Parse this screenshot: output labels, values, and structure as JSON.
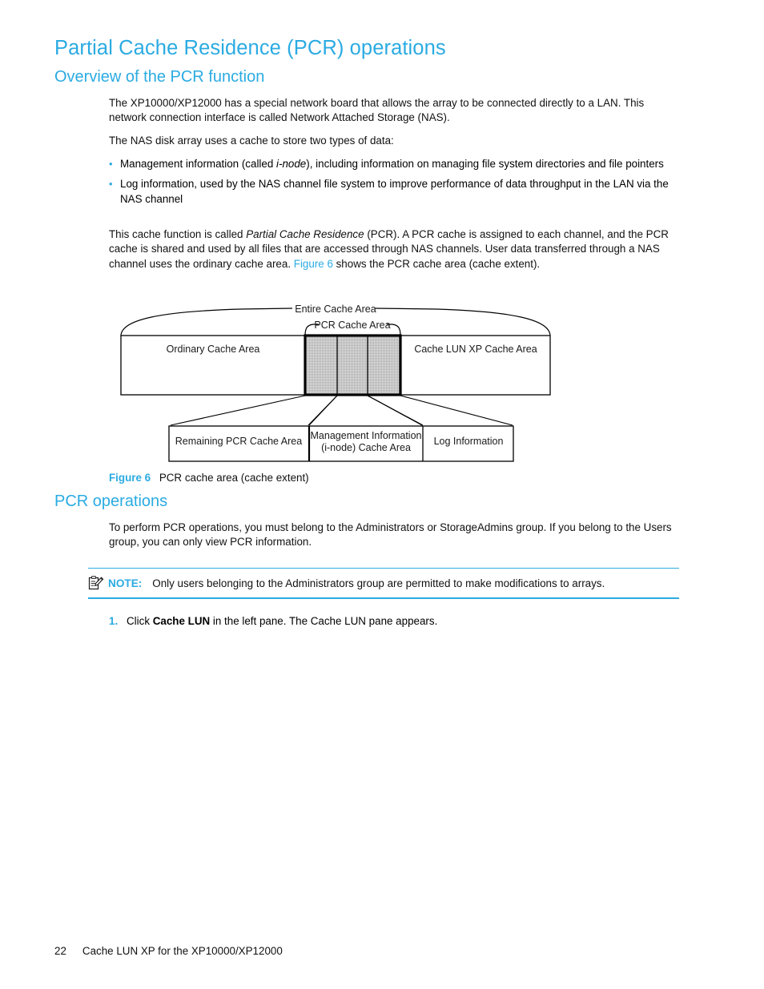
{
  "headings": {
    "title": "Partial Cache Residence (PCR) operations",
    "overview": "Overview of the PCR function",
    "pcr_operations": "PCR operations"
  },
  "paragraphs": {
    "p1_a": "The XP10000/XP12000 has a special network board that allows the array to be connected directly to a LAN. This network connection interface is called Network Attached Storage (NAS).",
    "p2": "The NAS disk array uses a cache to store two types of data:",
    "p3_part1": "This cache function is called ",
    "p3_italic": "Partial Cache Residence",
    "p3_part2": " (PCR). A PCR cache is assigned to each channel, and the PCR cache is shared and used by all files that are accessed through NAS channels. User data transferred through a NAS channel uses the ordinary cache area. ",
    "p3_link": "Figure 6",
    "p3_part3": " shows the PCR cache area (cache extent).",
    "p4": "To perform PCR operations, you must belong to the Administrators or StorageAdmins group. If you belong to the Users group, you can only view PCR information."
  },
  "bullets": [
    {
      "marker": "•",
      "pre": "Management information (called ",
      "italic": "i-node",
      "post": "), including information on managing file system directories and file pointers"
    },
    {
      "marker": "•",
      "pre": "Log information, used by the NAS channel file system to improve performance of data throughput in the LAN via the NAS channel",
      "italic": "",
      "post": ""
    }
  ],
  "figure": {
    "label": "Figure 6",
    "caption": "PCR cache area (cache extent)",
    "top_brace_label": "Entire Cache Area",
    "pcr_brace_label": "PCR Cache Area",
    "bar_segments": [
      {
        "name": "ordinary",
        "label": "Ordinary Cache Area",
        "fill": "#ffffff"
      },
      {
        "name": "pcr-cell-1",
        "label": "",
        "fill": "#c8c8c8"
      },
      {
        "name": "pcr-cell-2",
        "label": "",
        "fill": "#c8c8c8"
      },
      {
        "name": "pcr-cell-3",
        "label": "",
        "fill": "#c8c8c8"
      },
      {
        "name": "cache-lun-xp",
        "label": "Cache LUN XP Cache Area",
        "fill": "#ffffff"
      }
    ],
    "detail_boxes": [
      {
        "name": "remaining-pcr",
        "line1": "Remaining PCR Cache Area",
        "line2": ""
      },
      {
        "name": "management-information",
        "line1": "Management Information",
        "line2": "(i-node) Cache Area"
      },
      {
        "name": "log-information",
        "line1": "Log Information",
        "line2": ""
      }
    ]
  },
  "note": {
    "icon": "note-clipboard-icon",
    "label": "NOTE:",
    "text": "Only users belonging to the Administrators group are permitted to make modifications to arrays."
  },
  "steps": [
    {
      "number": "1.",
      "pre": "Click ",
      "bold": "Cache LUN",
      "post": " in the left pane. The Cache LUN pane appears."
    }
  ],
  "footer": {
    "page_number": "22",
    "doc_title": "Cache LUN XP for the XP10000/XP12000"
  },
  "colors": {
    "accent": "#2BABE2",
    "text": "#111111",
    "shade": "#c8c8c8"
  }
}
